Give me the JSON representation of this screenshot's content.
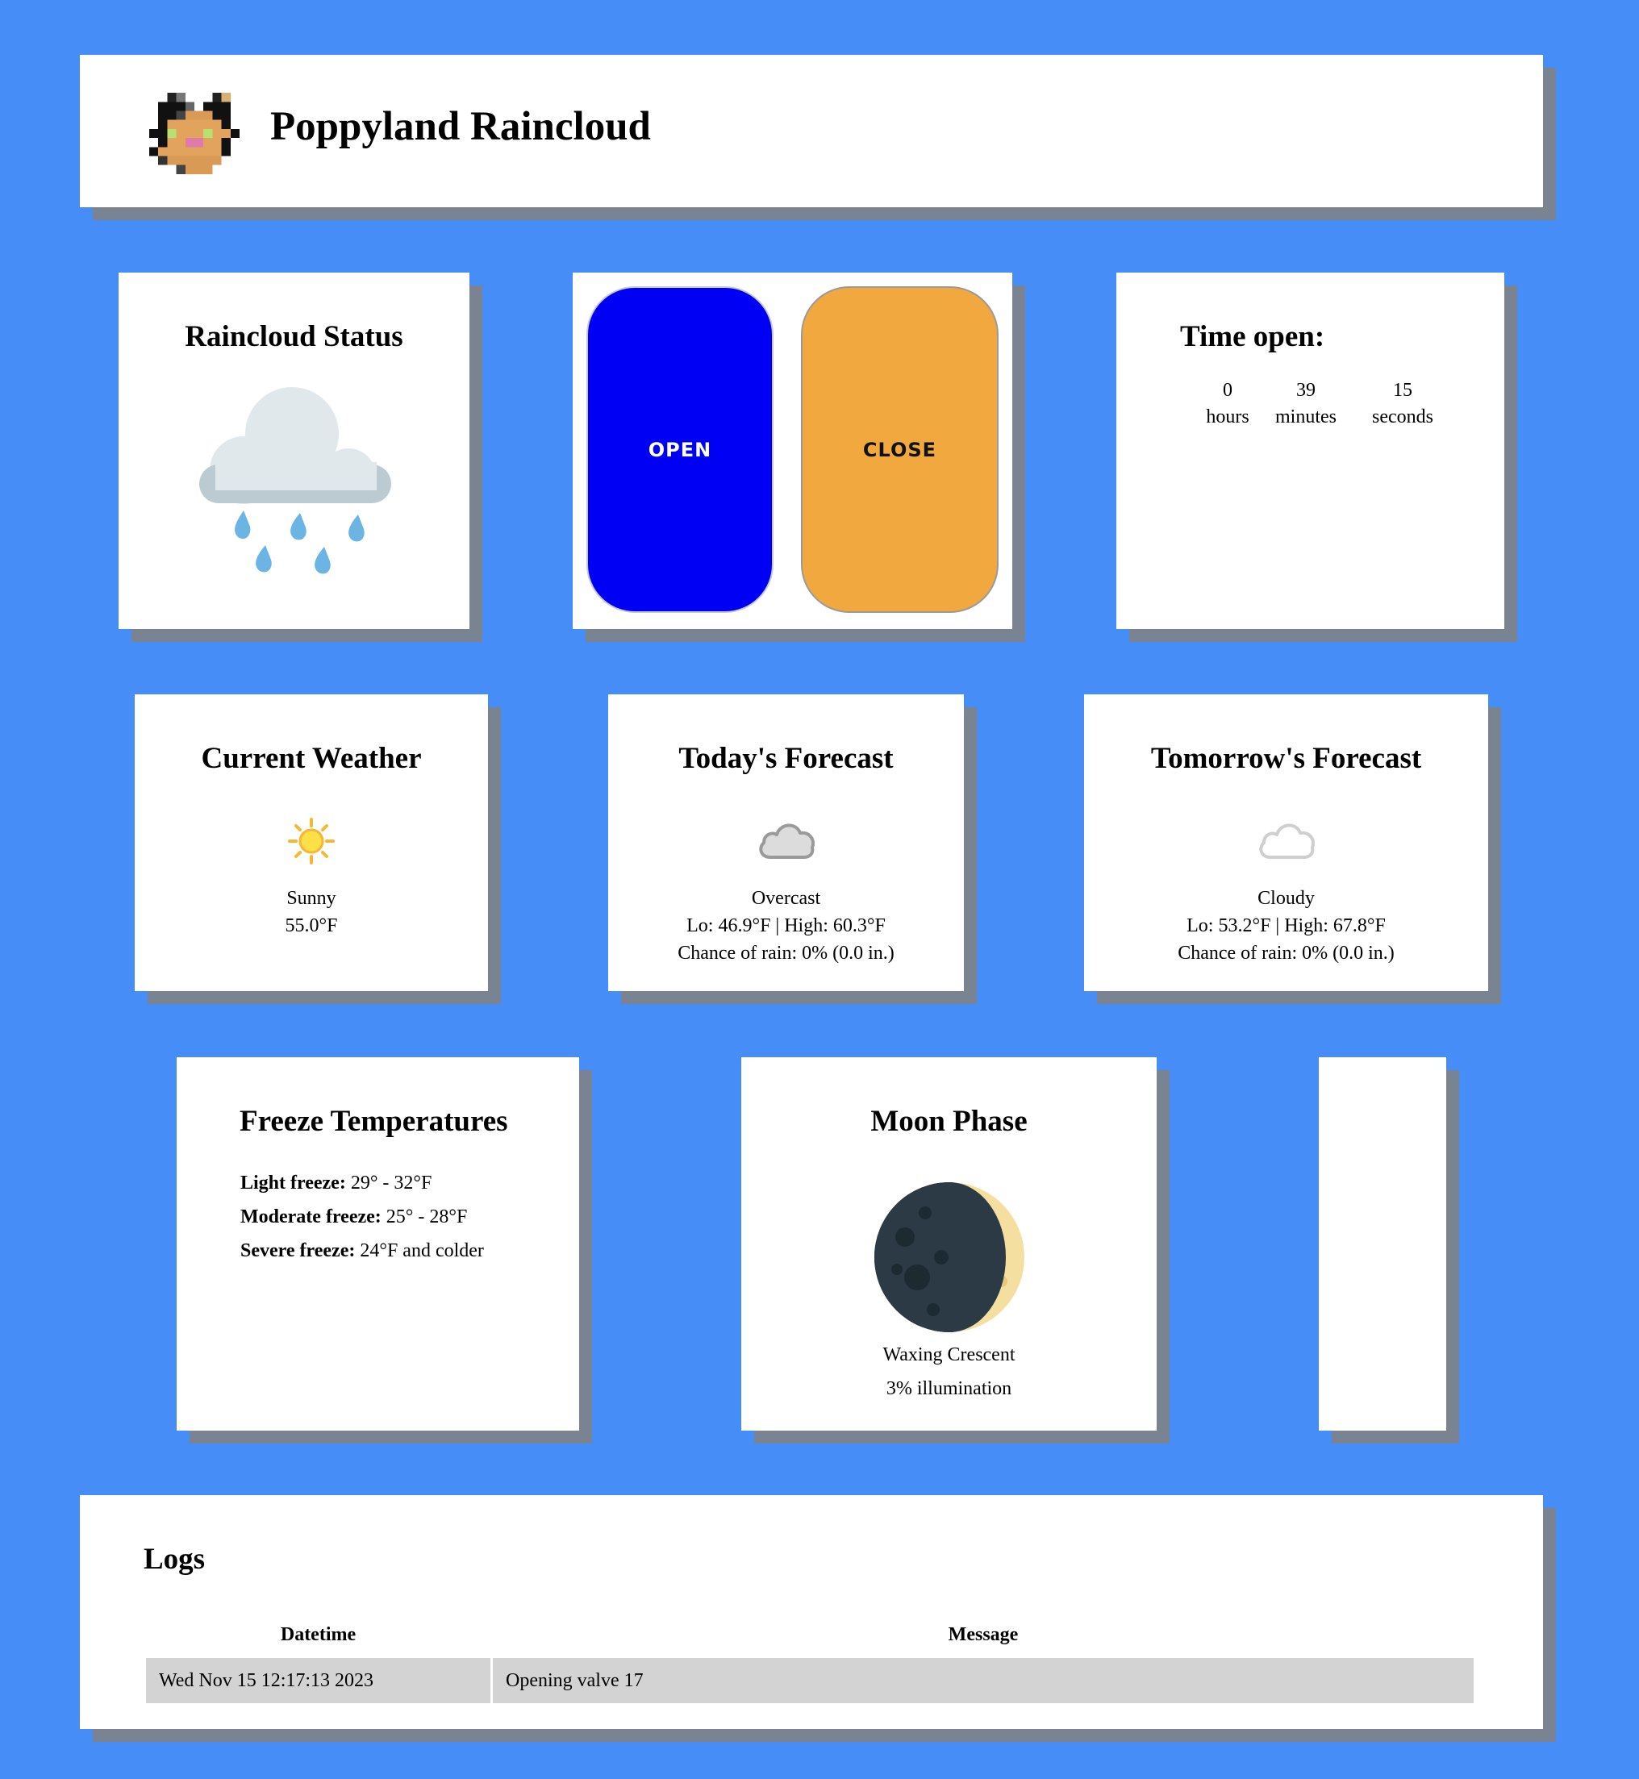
{
  "header": {
    "title": "Poppyland Raincloud",
    "logo_icon": "pixel-cat-logo-icon"
  },
  "status": {
    "title": "Raincloud Status",
    "icon": "rain-cloud-icon"
  },
  "controls": {
    "open_label": "OPEN",
    "close_label": "CLOSE",
    "open_color": "#0000f4",
    "close_color": "#f0a83f"
  },
  "timer": {
    "title": "Time open:",
    "hours": "0",
    "hours_label": "hours",
    "minutes": "39",
    "minutes_label": "minutes",
    "seconds": "15",
    "seconds_label": "seconds"
  },
  "current_weather": {
    "title": "Current Weather",
    "icon": "sun-icon",
    "condition": "Sunny",
    "temp": "55.0°F"
  },
  "today": {
    "title": "Today's Forecast",
    "icon": "cloud-icon",
    "condition": "Overcast",
    "range": "Lo: 46.9°F | High: 60.3°F",
    "rain": "Chance of rain: 0% (0.0 in.)"
  },
  "tomorrow": {
    "title": "Tomorrow's Forecast",
    "icon": "cloud-outline-icon",
    "condition": "Cloudy",
    "range": "Lo: 53.2°F | High: 67.8°F",
    "rain": "Chance of rain: 0% (0.0 in.)"
  },
  "freeze": {
    "title": "Freeze Temperatures",
    "light_label": "Light freeze:",
    "light_value": " 29° - 32°F",
    "moderate_label": "Moderate freeze:",
    "moderate_value": " 25° - 28°F",
    "severe_label": "Severe freeze:",
    "severe_value": " 24°F and colder"
  },
  "moon": {
    "title": "Moon Phase",
    "icon": "waxing-crescent-moon-icon",
    "phase": "Waxing Crescent",
    "illumination": "3% illumination"
  },
  "logs": {
    "title": "Logs",
    "columns": [
      "Datetime",
      "Message"
    ],
    "rows": [
      {
        "datetime": "Wed Nov 15 12:17:13 2023",
        "message": "Opening valve 17"
      }
    ]
  }
}
